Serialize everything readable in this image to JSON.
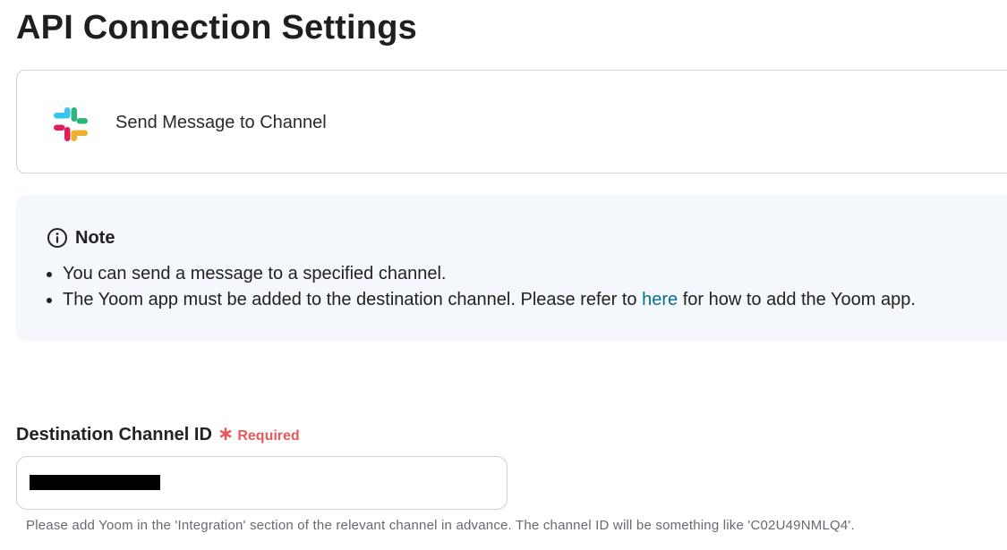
{
  "page": {
    "title": "API Connection Settings"
  },
  "action": {
    "icon": "slack-logo-icon",
    "label": "Send Message to Channel"
  },
  "note": {
    "icon": "info-icon",
    "title": "Note",
    "items": [
      {
        "text": "You can send a message to a specified channel."
      },
      {
        "text_before": "The Yoom app must be added to the destination channel. Please refer to ",
        "link": "here",
        "text_after": " for how to add the Yoom app."
      }
    ]
  },
  "channel_field": {
    "label": "Destination Channel ID",
    "required_mark": "∗",
    "required_label": "Required",
    "value": "",
    "value_redacted": true,
    "helper": "Please add Yoom in the 'Integration' section of the relevant channel in advance. The channel ID will be something like 'C02U49NMLQ4'."
  },
  "colors": {
    "required": "#e8595b",
    "link": "#0b6e8e",
    "note_bg": "#f4f7fb"
  }
}
